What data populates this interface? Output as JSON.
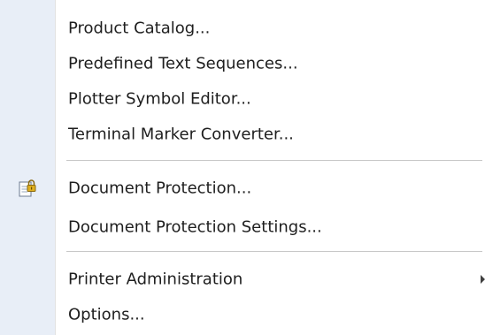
{
  "menu": {
    "items": [
      {
        "label": "Product Catalog..."
      },
      {
        "label": "Predefined Text Sequences..."
      },
      {
        "label": "Plotter Symbol Editor..."
      },
      {
        "label": "Terminal Marker Converter..."
      },
      {
        "label": "Document Protection...",
        "icon": "document-lock-icon"
      },
      {
        "label": "Document Protection Settings..."
      },
      {
        "label": "Printer Administration",
        "has_submenu": true
      },
      {
        "label": "Options..."
      }
    ]
  },
  "colors": {
    "gutter": "#e8eef7",
    "text": "#1e1e1e",
    "separator": "#c8c8c8",
    "icon_gold": "#e0b020"
  }
}
